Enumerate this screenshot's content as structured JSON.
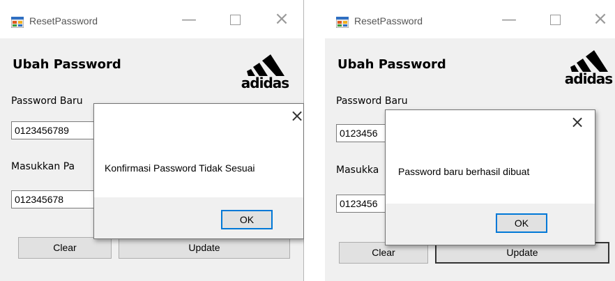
{
  "windows": [
    {
      "title": "ResetPassword",
      "heading": "Ubah Password",
      "logo_text": "adidas",
      "label_new": "Password Baru",
      "label_confirm": "Masukkan Pa",
      "new_password_value": "0123456789",
      "confirm_password_value": "012345678",
      "clear_label": "Clear",
      "update_label": "Update",
      "dialog": {
        "message": "Konfirmasi Password Tidak Sesuai",
        "ok_label": "OK",
        "close_glyph": "×"
      }
    },
    {
      "title": "ResetPassword",
      "heading": "Ubah Password",
      "logo_text": "adidas",
      "label_new": "Password Baru",
      "label_confirm": "Masukka",
      "new_password_value": "0123456",
      "confirm_password_value": "0123456",
      "clear_label": "Clear",
      "update_label": "Update",
      "dialog": {
        "message": "Password baru berhasil dibuat",
        "ok_label": "OK",
        "close_glyph": "×"
      }
    }
  ],
  "window_controls": {
    "minimize": "—",
    "close": "×"
  },
  "icons": {
    "app": "app-form-icon",
    "minimize": "minimize-icon",
    "maximize": "maximize-icon",
    "close": "close-icon",
    "logo": "adidas-logo"
  }
}
